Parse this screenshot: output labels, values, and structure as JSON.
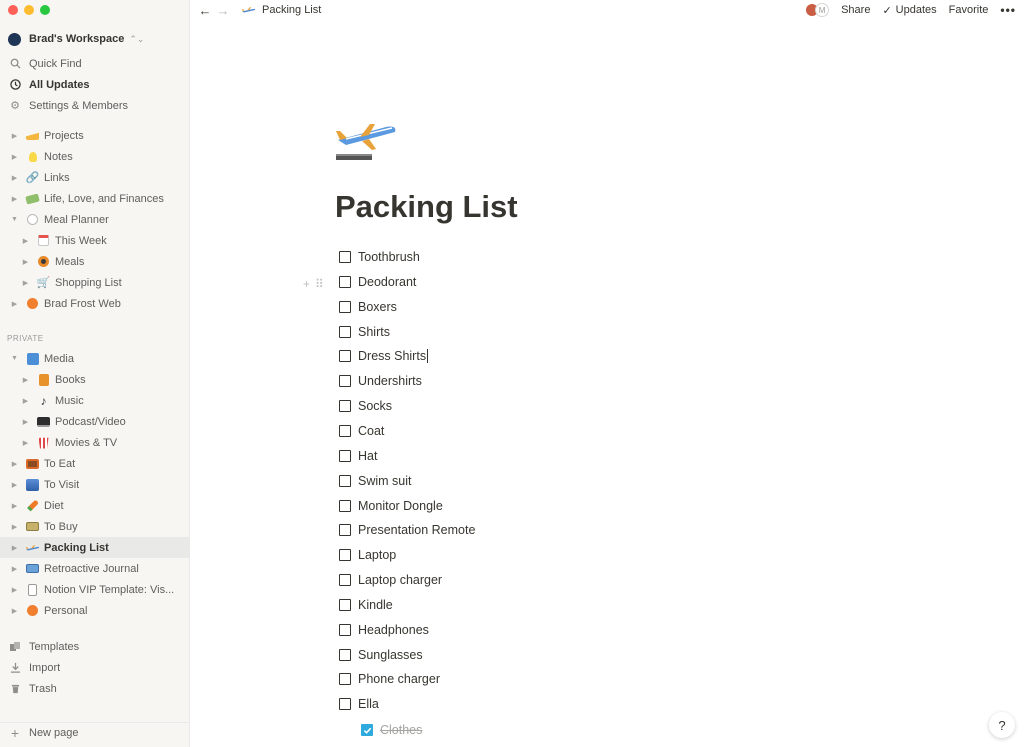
{
  "sidebar": {
    "workspace": "Brad's Workspace",
    "utility": [
      {
        "label": "Quick Find",
        "icon": "search-icon"
      },
      {
        "label": "All Updates",
        "icon": "clock-icon"
      },
      {
        "label": "Settings & Members",
        "icon": "gear-icon"
      }
    ],
    "workspace_pages": [
      {
        "label": "Projects",
        "icon": "cheese-icon"
      },
      {
        "label": "Notes",
        "icon": "lightbulb-icon"
      },
      {
        "label": "Links",
        "icon": "link-icon"
      },
      {
        "label": "Life, Love, and Finances",
        "icon": "money-icon"
      },
      {
        "label": "Meal Planner",
        "icon": "plate-icon"
      },
      {
        "label": "This Week",
        "icon": "calendar-icon"
      },
      {
        "label": "Meals",
        "icon": "pan-icon"
      },
      {
        "label": "Shopping List",
        "icon": "cart-icon"
      },
      {
        "label": "Brad Frost Web",
        "icon": "peach-icon"
      }
    ],
    "private_label": "PRIVATE",
    "private_pages": [
      {
        "label": "Media",
        "icon": "media-icon"
      },
      {
        "label": "Books",
        "icon": "book-icon"
      },
      {
        "label": "Music",
        "icon": "music-note-icon"
      },
      {
        "label": "Podcast/Video",
        "icon": "computer-icon"
      },
      {
        "label": "Movies & TV",
        "icon": "popcorn-icon"
      },
      {
        "label": "To Eat",
        "icon": "bento-icon"
      },
      {
        "label": "To Visit",
        "icon": "cityscape-icon"
      },
      {
        "label": "Diet",
        "icon": "carrot-icon"
      },
      {
        "label": "To Buy",
        "icon": "banknote-icon"
      },
      {
        "label": "Packing List",
        "icon": "airplane-icon"
      },
      {
        "label": "Retroactive Journal",
        "icon": "open-book-icon"
      },
      {
        "label": "Notion VIP Template: Vis...",
        "icon": "document-icon"
      },
      {
        "label": "Personal",
        "icon": "peach-icon"
      }
    ],
    "bottom": [
      {
        "label": "Templates",
        "icon": "templates-icon"
      },
      {
        "label": "Import",
        "icon": "import-icon"
      },
      {
        "label": "Trash",
        "icon": "trash-icon"
      }
    ],
    "new_page": "New page"
  },
  "topbar": {
    "breadcrumb": "Packing List",
    "avatar_initial": "M",
    "share": "Share",
    "updates": "Updates",
    "favorite": "Favorite",
    "more": "•••"
  },
  "page": {
    "title": "Packing List",
    "todos": [
      {
        "text": "Toothbrush",
        "checked": false
      },
      {
        "text": "Deodorant",
        "checked": false
      },
      {
        "text": "Boxers",
        "checked": false
      },
      {
        "text": "Shirts",
        "checked": false
      },
      {
        "text": "Dress Shirts",
        "checked": false
      },
      {
        "text": "Undershirts",
        "checked": false
      },
      {
        "text": "Socks",
        "checked": false
      },
      {
        "text": "Coat",
        "checked": false
      },
      {
        "text": "Hat",
        "checked": false
      },
      {
        "text": "Swim suit",
        "checked": false
      },
      {
        "text": "Monitor Dongle",
        "checked": false
      },
      {
        "text": "Presentation Remote",
        "checked": false
      },
      {
        "text": "Laptop",
        "checked": false
      },
      {
        "text": "Laptop charger",
        "checked": false
      },
      {
        "text": "Kindle",
        "checked": false
      },
      {
        "text": "Headphones",
        "checked": false
      },
      {
        "text": "Sunglasses",
        "checked": false
      },
      {
        "text": "Phone charger",
        "checked": false
      },
      {
        "text": "Ella",
        "checked": false
      }
    ],
    "nested_todo": {
      "text": "Clothes",
      "checked": true
    }
  },
  "help_label": "?",
  "colors": {
    "sidebar_bg": "#f7f6f3",
    "active_row": "#e9e9e7",
    "checkbox_checked": "#2eaadc",
    "text": "#37352f"
  }
}
